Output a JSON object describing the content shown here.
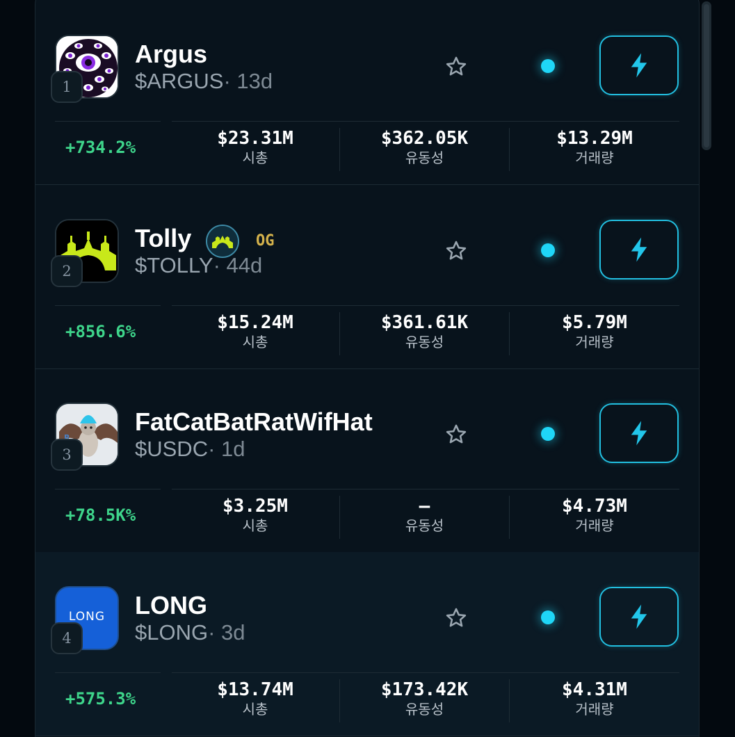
{
  "tokens": [
    {
      "rank": "1",
      "name": "Argus",
      "ticker": "$ARGUS",
      "age": "· 13d",
      "change": "+734.2%",
      "market_cap": "$23.31M",
      "market_cap_label": "시총",
      "liquidity": "$362.05K",
      "liquidity_label": "유동성",
      "volume": "$13.29M",
      "volume_label": "거래량"
    },
    {
      "rank": "2",
      "name": "Tolly",
      "badge": "OG",
      "ticker": "$TOLLY",
      "age": "· 44d",
      "change": "+856.6%",
      "market_cap": "$15.24M",
      "market_cap_label": "시총",
      "liquidity": "$361.61K",
      "liquidity_label": "유동성",
      "volume": "$5.79M",
      "volume_label": "거래량"
    },
    {
      "rank": "3",
      "name": "FatCatBatRatWifHat",
      "ticker": "$USDC",
      "age": "· 1d",
      "change": "+78.5K%",
      "market_cap": "$3.25M",
      "market_cap_label": "시총",
      "liquidity": "—",
      "liquidity_label": "유동성",
      "volume": "$4.73M",
      "volume_label": "거래량"
    },
    {
      "rank": "4",
      "name": "LONG",
      "logo_text": "LONG",
      "ticker": "$LONG",
      "age": "· 3d",
      "change": "+575.3%",
      "market_cap": "$13.74M",
      "market_cap_label": "시총",
      "liquidity": "$173.42K",
      "liquidity_label": "유동성",
      "volume": "$4.31M",
      "volume_label": "거래량"
    }
  ],
  "icons": {
    "favorite": "star-outline-icon",
    "live": "live-status-dot",
    "quick_buy": "lightning-bolt-icon"
  },
  "colors": {
    "accent": "#1fd6f7",
    "positive": "#3ed58b",
    "og_badge": "#d4b24c",
    "panel_bg": "#08131c"
  }
}
